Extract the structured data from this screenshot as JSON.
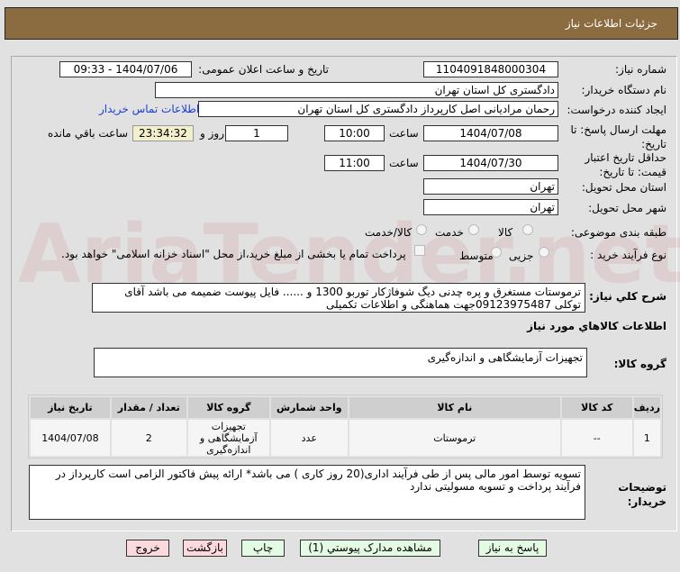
{
  "header": {
    "title": "جزئیات اطلاعات نیاز"
  },
  "fields": {
    "need_number_label": "شماره نیاز:",
    "need_number": "1104091848000304",
    "announce_label": "تاریخ و ساعت اعلان عمومی:",
    "announce_value": "1404/07/06 - 09:33",
    "buyer_label": "نام دستگاه خریدار:",
    "buyer": "دادگستری کل استان تهران",
    "creator_label": "ایجاد کننده درخواست:",
    "creator": "رحمان مرادیانی اصل کارپرداز دادگستری کل استان تهران",
    "contact_link": "اطلاعات تماس خریدار",
    "deadline_label": "مهلت ارسال پاسخ: تا تاریخ:",
    "deadline_date": "1404/07/08",
    "time_label": "ساعت",
    "deadline_time": "10:00",
    "days": "1",
    "days_label": "روز و",
    "remaining": "23:34:32",
    "remaining_label": "ساعت باقي مانده",
    "validity_label": "حداقل تاریخ اعتبار قیمت: تا تاریخ:",
    "validity_date": "1404/07/30",
    "validity_time": "11:00",
    "province_label": "استان محل تحویل:",
    "province": "تهران",
    "city_label": "شهر محل تحویل:",
    "city": "تهران",
    "category_label": "طبقه بندی موضوعی:",
    "category_options": [
      "کالا",
      "خدمت",
      "کالا/خدمت"
    ],
    "process_label": "نوع فرآیند خرید :",
    "process_options": [
      "جزیی",
      "متوسط"
    ],
    "payment_note": "پرداخت تمام یا بخشی از مبلغ خرید،از محل \"اسناد خزانه اسلامی\" خواهد بود.",
    "description_label": "شرح کلي نیاز:",
    "description": "ترموستات مستغرق و پره چدنی دیگ شوفاژکار توربو 1300 و ...... فایل پیوست ضمیمه می باشد آقای توکلی 09123975487جهت هماهنگی و اطلاعات تکمیلی",
    "goods_info_title": "اطلاعات کالاهاي مورد نیاز",
    "goods_group_label": "گروه کالا:",
    "goods_group": "تجهیزات آزمایشگاهی و اندازه‌گیری"
  },
  "table": {
    "headers": [
      "ردیف",
      "کد کالا",
      "نام کالا",
      "واحد شمارش",
      "گروه کالا",
      "تعداد / مقدار",
      "تاریخ نیاز"
    ],
    "rows": [
      [
        "1",
        "--",
        "ترموستات",
        "عدد",
        "تجهیزات آزمایشگاهی و اندازه‌گیری",
        "2",
        "1404/07/08"
      ]
    ]
  },
  "notes": {
    "label": "توضیحات خریدار:",
    "text": "تسویه توسط امور مالی پس از طی فرآیند اداری(20 روز کاری )  می باشد* ارائه پیش فاکتور الزامی است کارپرداز در فرآیند پرداخت و تسویه  مسولیتی ندارد"
  },
  "buttons": {
    "reply": "پاسخ به نیاز",
    "attachments": "مشاهده مدارک پیوستي (1)",
    "print": "چاپ",
    "back": "بازگشت",
    "exit": "خروج"
  },
  "watermark": "AriaTender.net"
}
